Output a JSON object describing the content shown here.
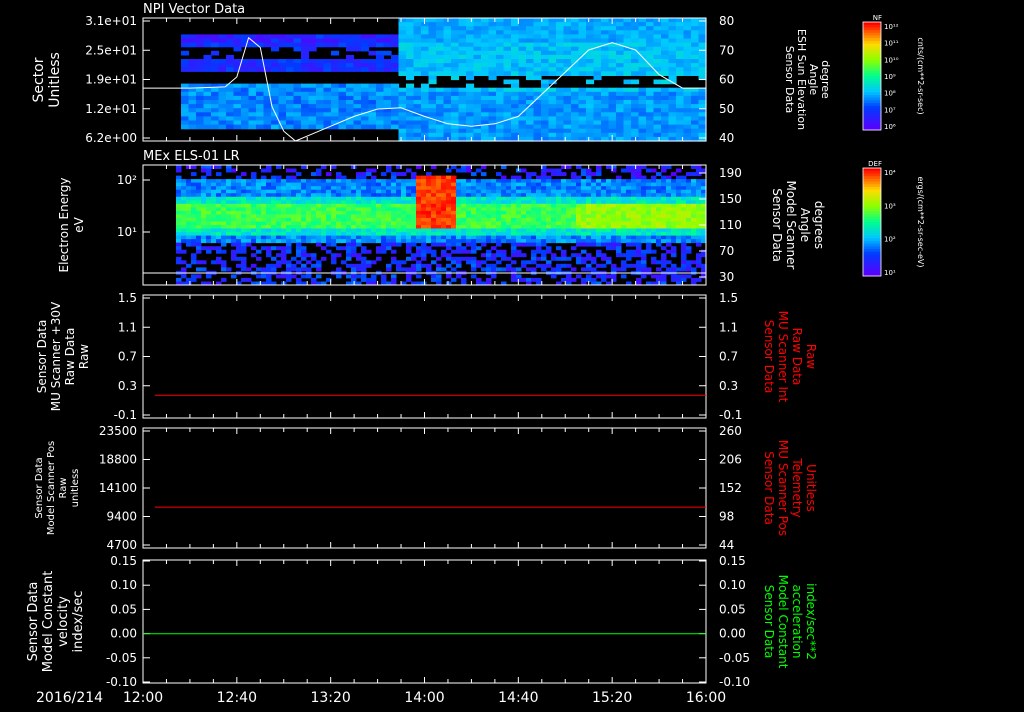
{
  "colors": {
    "background": "#000000",
    "foreground": "#ffffff",
    "red_trace": "#ff0000",
    "green_trace": "#00ff00",
    "spectrogram_low": "#2200ff",
    "spectrogram_high": "#ff0000"
  },
  "chart_data": [
    {
      "type": "heatmap",
      "title": "NPI Vector Data",
      "ylabel": [
        "Sector",
        "Unitless"
      ],
      "yticks": [
        "3.1e+01",
        "2.5e+01",
        "1.9e+01",
        "1.2e+01",
        "6.2e+00"
      ],
      "right_ylabel": [
        "Sensor Data",
        "ESH Sun Elevation",
        "Angle",
        "degree"
      ],
      "right_yticks": [
        "80",
        "70",
        "60",
        "50",
        "40"
      ],
      "right_ylim": [
        30,
        80
      ],
      "overlay_line": {
        "x_min": [
          0,
          20,
          35,
          40,
          45,
          50,
          55,
          60,
          65,
          70,
          80,
          90,
          100,
          110,
          120,
          130,
          140,
          150,
          160,
          170,
          180,
          190,
          200,
          210,
          220,
          230,
          240
        ],
        "y_deg": [
          51.5,
          51.5,
          52,
          56,
          72,
          68,
          44,
          34,
          30,
          32,
          36,
          40,
          43,
          43.5,
          40,
          37,
          36,
          37,
          40,
          49,
          58,
          67,
          70,
          67,
          57,
          51.5,
          51.5
        ]
      },
      "colorbar": {
        "label": "NF",
        "units": "cnts/(cm**2-sr-sec)",
        "ticks": [
          "10¹²",
          "10¹¹",
          "10¹⁰",
          "10⁹",
          "10⁸",
          "10⁷",
          "10⁶"
        ]
      }
    },
    {
      "type": "heatmap",
      "title": "MEx ELS-01 LR",
      "ylabel": [
        "Electron Energy",
        "eV"
      ],
      "yticks": [
        "10²",
        "10¹"
      ],
      "right_ylabel": [
        "Sensor Data",
        "Model Scanner",
        "Angle",
        "degrees"
      ],
      "right_yticks": [
        "190",
        "150",
        "110",
        "70",
        "30"
      ],
      "right_ylim": [
        0,
        190
      ],
      "overlay_line": {
        "x_min": [
          0,
          240
        ],
        "y_deg": [
          10,
          10
        ]
      },
      "colorbar": {
        "label": "DEF",
        "units": "ergs/(cm**2-sr-sec-eV)",
        "ticks": [
          "10⁴",
          "10³",
          "10²",
          "10¹"
        ]
      }
    },
    {
      "type": "line",
      "ylabel": [
        "Sensor Data",
        "MU Scanner +30V",
        "Raw Data",
        "Raw"
      ],
      "yticks": [
        "1.5",
        "1.1",
        "0.7",
        "0.3",
        "-0.1"
      ],
      "right_ylabel": [
        "Sensor Data",
        "MU Scanner Int",
        "Raw Data",
        "Raw"
      ],
      "right_yticks": [
        "1.5",
        "1.1",
        "0.7",
        "0.3",
        "-0.1"
      ],
      "ylim": [
        -0.4,
        1.5
      ],
      "series": [
        {
          "x": [
            5,
            240
          ],
          "y": [
            -0.05,
            -0.05
          ]
        }
      ]
    },
    {
      "type": "line",
      "ylabel": [
        "Sensor Data",
        "Model Scanner Pos",
        "Raw",
        "unitless"
      ],
      "yticks": [
        "23500",
        "18800",
        "14100",
        "9400",
        "4700"
      ],
      "right_ylabel": [
        "Sensor Data",
        "MU Scanner Pos",
        "Telemetry",
        "Unitless"
      ],
      "right_yticks": [
        "260",
        "206",
        "152",
        "98",
        "44"
      ],
      "ylim": [
        0,
        23500
      ],
      "series": [
        {
          "x": [
            5,
            240
          ],
          "y": [
            8000,
            8000
          ]
        }
      ]
    },
    {
      "type": "line",
      "ylabel": [
        "Sensor Data",
        "Model Constant",
        "velocity",
        "index/sec"
      ],
      "yticks": [
        "0.15",
        "0.10",
        "0.05",
        "0.00",
        "-0.05",
        "-0.10"
      ],
      "right_ylabel": [
        "Sensor Data",
        "Model Constant",
        "acceleration",
        "index/sec**2"
      ],
      "right_yticks": [
        "0.15",
        "0.10",
        "0.05",
        "0.00",
        "-0.05",
        "-0.10"
      ],
      "ylim": [
        -0.1,
        0.15
      ],
      "series": [
        {
          "x": [
            0,
            240
          ],
          "y": [
            0,
            0
          ]
        }
      ]
    }
  ],
  "time_axis": {
    "date": "2016/214",
    "labels": [
      "12:00",
      "12:40",
      "13:20",
      "14:00",
      "14:40",
      "15:20",
      "16:00"
    ],
    "span_minutes": 240
  }
}
